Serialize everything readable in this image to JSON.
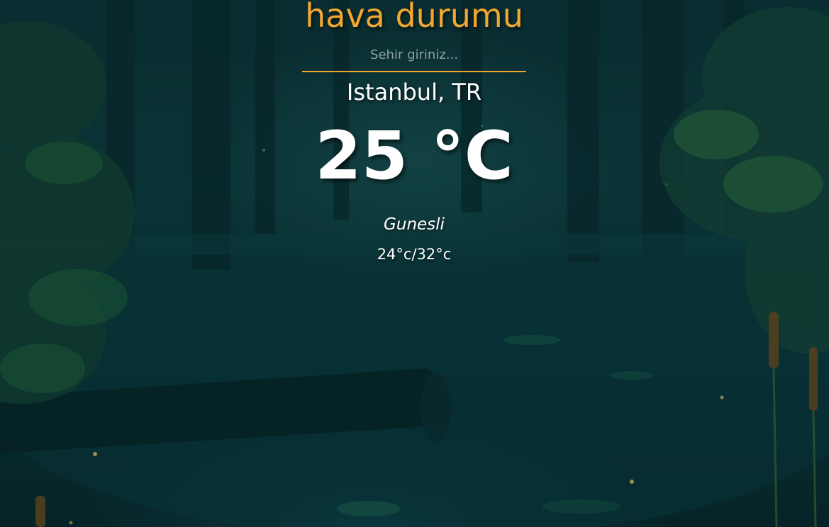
{
  "app": {
    "title": "hava durumu"
  },
  "search": {
    "placeholder": "Sehir giriniz...",
    "value": ""
  },
  "weather": {
    "location": "Istanbul, TR",
    "temperature": "25",
    "unit": "°C",
    "condition": "Gunesli",
    "min_max": "24°c/32°c"
  },
  "theme": {
    "accent_color": "#f2a731",
    "text_color": "#ffffff",
    "background": "dark teal night forest"
  }
}
